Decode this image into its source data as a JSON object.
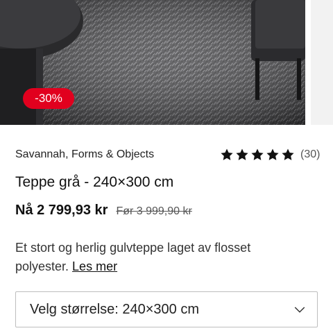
{
  "product": {
    "discount_badge": "-30%",
    "brand": "Savannah, Forms & Objects",
    "rating": {
      "stars": 5,
      "count_label": "(30)"
    },
    "title": "Teppe grå - 240×300 cm",
    "price_now": "Nå 2 799,93 kr",
    "price_before": "Før 3 999,90 kr",
    "description": "Et stort og herlig gulvteppe laget av flosset polyester.",
    "read_more": "Les mer",
    "size_select": {
      "label": "Velg størrelse: 240×300 cm",
      "icon": "chevron-down-icon"
    }
  },
  "colors": {
    "badge": "#e1001e",
    "text": "#111111",
    "star": "#111111"
  }
}
